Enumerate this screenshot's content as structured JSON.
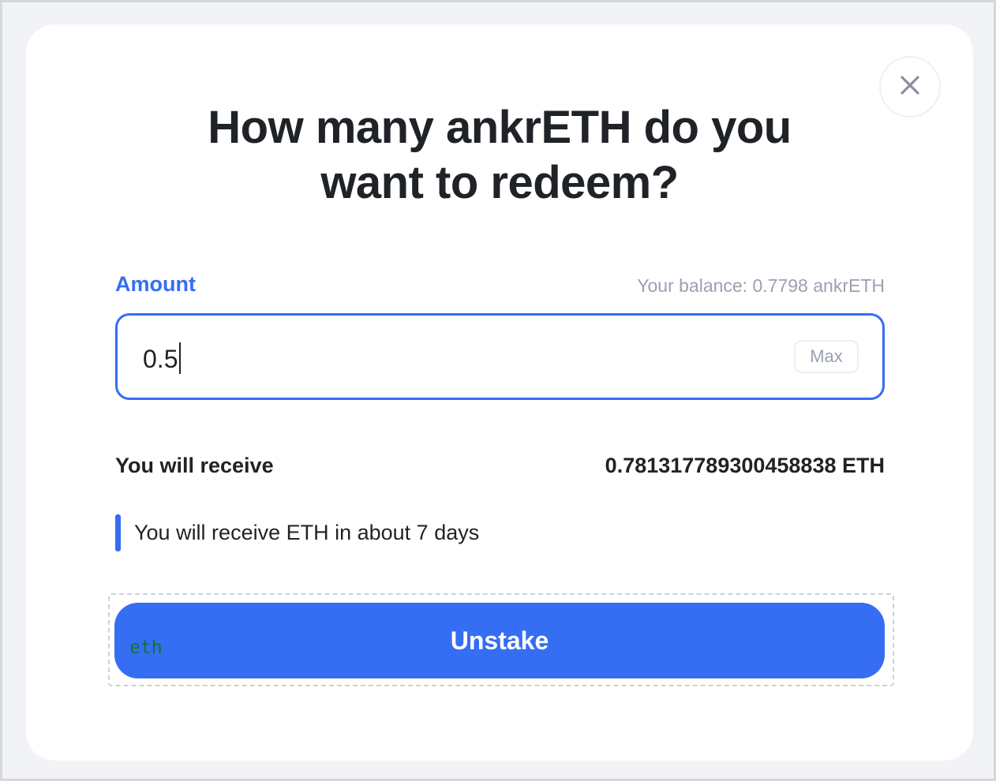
{
  "dialog": {
    "title_line1": "How many ankrETH do you",
    "title_line2": "want to redeem?",
    "close_icon": "close-icon"
  },
  "form": {
    "amount_label": "Amount",
    "balance_prefix": "Your balance: ",
    "balance_value": "0.7798",
    "balance_unit": "ankrETH",
    "amount_value": "0.5",
    "max_label": "Max"
  },
  "summary": {
    "receive_label": "You will receive",
    "receive_amount": "0.781317789300458838",
    "receive_unit": "ETH",
    "info_text": "You will receive ETH in about 7 days"
  },
  "actions": {
    "unstake_label": "Unstake",
    "debug_tag": "eth"
  },
  "colors": {
    "accent": "#356df3",
    "text": "#1f2226",
    "muted": "#9aa1b0",
    "debug_tag": "#17712f"
  }
}
